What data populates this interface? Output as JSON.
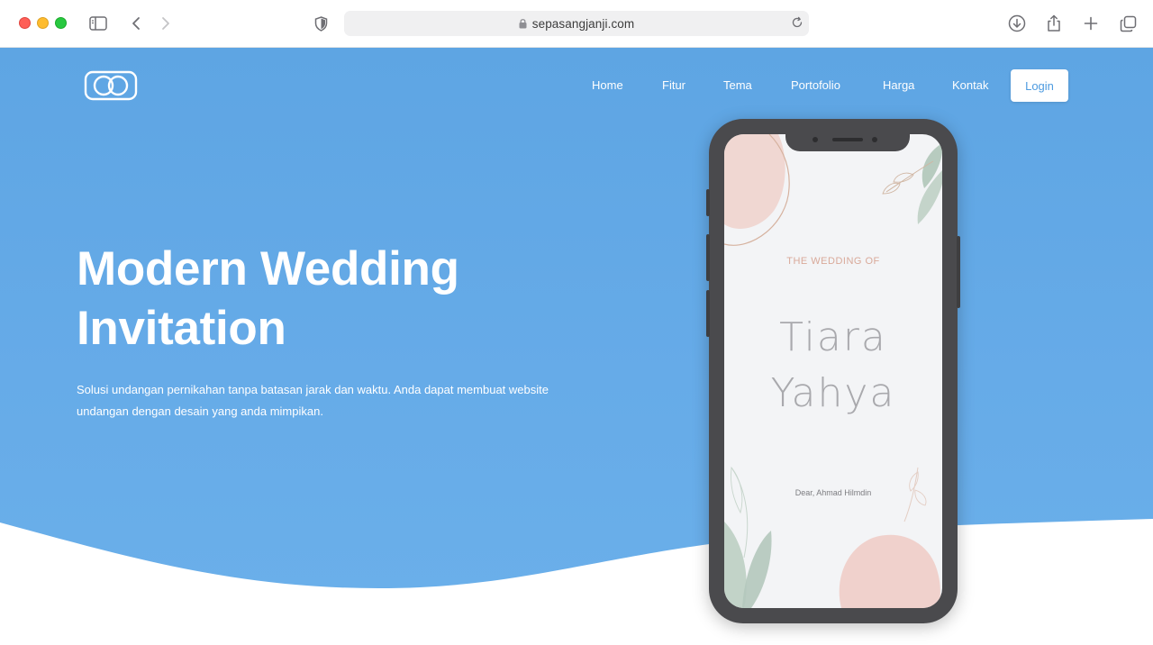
{
  "browser": {
    "url": "sepasangjanji.com"
  },
  "nav": {
    "items": [
      {
        "label": "Home"
      },
      {
        "label": "Fitur"
      },
      {
        "label": "Tema"
      },
      {
        "label": "Portofolio"
      },
      {
        "label": "Harga"
      },
      {
        "label": "Kontak"
      }
    ],
    "login_label": "Login"
  },
  "hero": {
    "headline_line1": "Modern Wedding",
    "headline_line2": "Invitation",
    "subtext": "Solusi undangan pernikahan tanpa batasan jarak dan waktu. Anda dapat membuat website undangan dengan desain yang anda mimpikan."
  },
  "phone": {
    "wedding_of": "THE WEDDING OF",
    "name_1": "Tiara",
    "name_2": "Yahya",
    "guest": "Dear, Ahmad Hilmdin"
  },
  "colors": {
    "hero_blue": "#5ea5e3",
    "white": "#ffffff",
    "phone_frame": "#4a4a4d",
    "blush": "#f0d4d0",
    "sage": "#b9cdc3"
  }
}
